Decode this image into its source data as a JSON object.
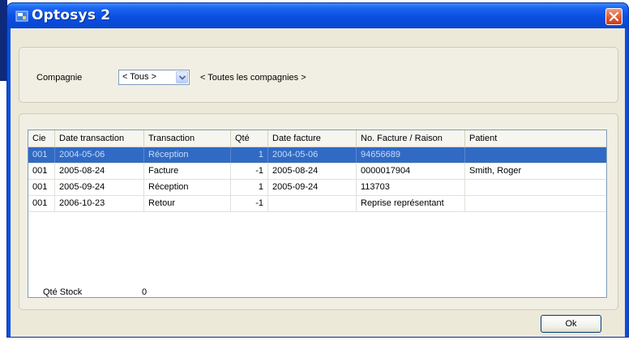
{
  "window": {
    "title": "Optosys 2"
  },
  "filter": {
    "company_label": "Compagnie",
    "company_value": "< Tous >",
    "company_description": "< Toutes les compagnies >"
  },
  "table": {
    "columns": [
      "Cie",
      "Date transaction",
      "Transaction",
      "Qté",
      "Date facture",
      "No. Facture / Raison",
      "Patient"
    ],
    "rows": [
      {
        "cie": "001",
        "date_transaction": "2004-05-06",
        "transaction": "Réception",
        "qte": "1",
        "date_facture": "2004-05-06",
        "no_facture": "94656689",
        "patient": "",
        "selected": true
      },
      {
        "cie": "001",
        "date_transaction": "2005-08-24",
        "transaction": "Facture",
        "qte": "-1",
        "date_facture": "2005-08-24",
        "no_facture": "0000017904",
        "patient": "Smith, Roger",
        "selected": false
      },
      {
        "cie": "001",
        "date_transaction": "2005-09-24",
        "transaction": "Réception",
        "qte": "1",
        "date_facture": "2005-09-24",
        "no_facture": "113703",
        "patient": "",
        "selected": false
      },
      {
        "cie": "001",
        "date_transaction": "2006-10-23",
        "transaction": "Retour",
        "qte": "-1",
        "date_facture": "",
        "no_facture": "Reprise représentant",
        "patient": "",
        "selected": false
      }
    ]
  },
  "stock": {
    "label": "Qté Stock",
    "value": "0"
  },
  "buttons": {
    "ok": "Ok"
  },
  "colors": {
    "titlebar": "#0a4fe0",
    "selection": "#316ac5",
    "dialog_bg": "#ece9d8",
    "close": "#e0552e"
  }
}
